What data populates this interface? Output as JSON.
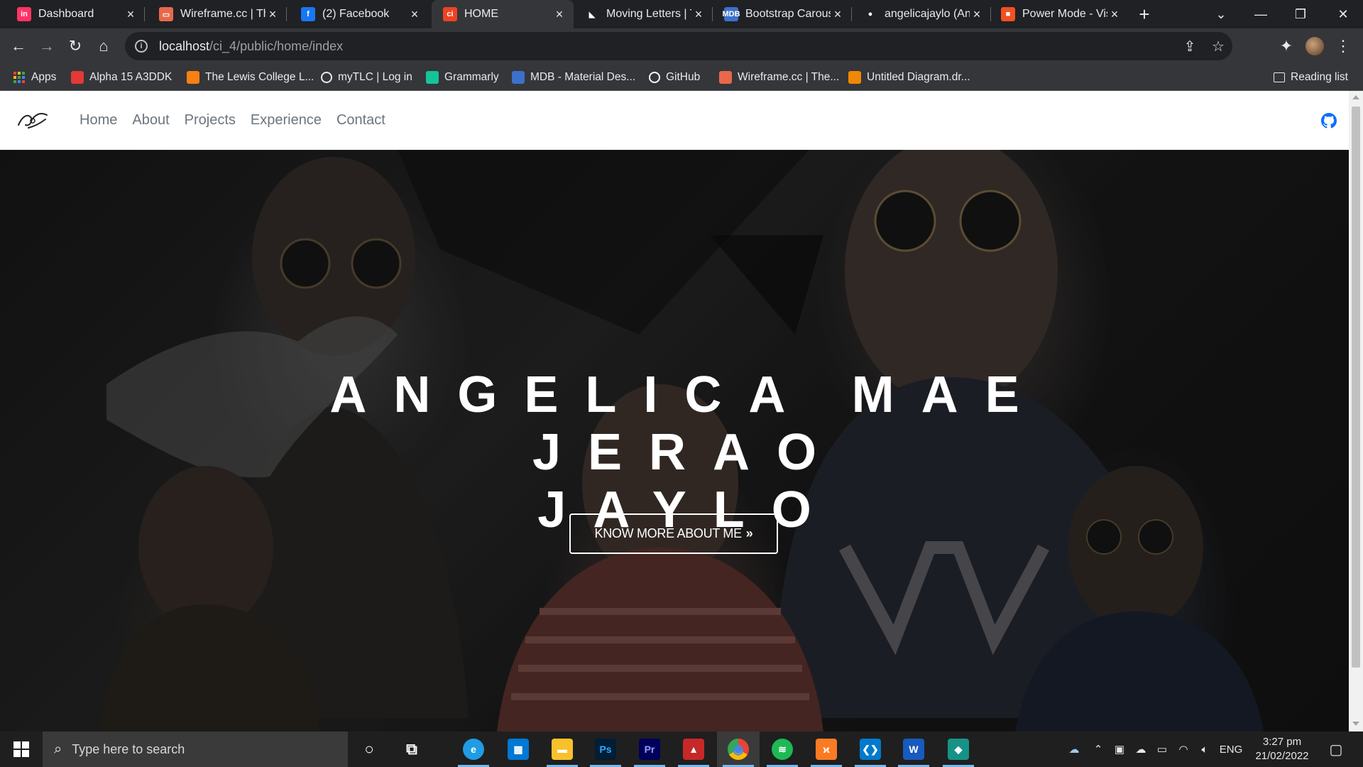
{
  "browser": {
    "tabs": [
      {
        "title": "Dashboard",
        "favicon": "invision-icon",
        "color": "#ff3366",
        "glyph": "in"
      },
      {
        "title": "Wireframe.cc | The",
        "favicon": "wireframe-icon",
        "color": "#e8684a",
        "glyph": "▭"
      },
      {
        "title": "(2) Facebook",
        "favicon": "facebook-icon",
        "color": "#1877f2",
        "glyph": "f"
      },
      {
        "title": "HOME",
        "favicon": "codeigniter-icon",
        "color": "#ee4323",
        "glyph": "ci",
        "active": true
      },
      {
        "title": "Moving Letters | T",
        "favicon": "moving-letters-icon",
        "color": "#ffffff",
        "glyph": "◣"
      },
      {
        "title": "Bootstrap Carous",
        "favicon": "mdb-icon",
        "color": "#3b71ca",
        "glyph": "MDB"
      },
      {
        "title": "angelicajaylo (An",
        "favicon": "github-icon",
        "color": "#ffffff",
        "glyph": "●"
      },
      {
        "title": "Power Mode - Vis",
        "favicon": "microsoft-icon",
        "color": "#f25022",
        "glyph": "■"
      }
    ],
    "address": {
      "host": "localhost",
      "path": "/ci_4/public/home/index"
    },
    "bookmarks": [
      {
        "label": "Apps",
        "icon": "apps-grid-icon",
        "color": "#4285f4"
      },
      {
        "label": "Alpha 15 A3DDK",
        "icon": "msi-icon",
        "color": "#e53935"
      },
      {
        "label": "The Lewis College L...",
        "icon": "moodle-icon",
        "color": "#f98012"
      },
      {
        "label": "myTLC | Log in",
        "icon": "globe-icon",
        "color": "#e8eaed"
      },
      {
        "label": "Grammarly",
        "icon": "grammarly-icon",
        "color": "#15c39a"
      },
      {
        "label": "MDB - Material Des...",
        "icon": "mdb-icon",
        "color": "#3b71ca"
      },
      {
        "label": "GitHub",
        "icon": "github-icon",
        "color": "#ffffff"
      },
      {
        "label": "Wireframe.cc | The...",
        "icon": "wireframe-icon",
        "color": "#e8684a"
      },
      {
        "label": "Untitled Diagram.dr...",
        "icon": "drawio-icon",
        "color": "#f08705"
      }
    ],
    "reading_list": "Reading list"
  },
  "site": {
    "nav": [
      "Home",
      "About",
      "Projects",
      "Experience",
      "Contact"
    ],
    "hero": {
      "title_lines": [
        "ANGELICA MAE",
        "JERAO",
        "JAYLO"
      ],
      "cta": "KNOW MORE ABOUT ME"
    },
    "colors": {
      "accent": "#0d6efd",
      "nav_text": "#6c757d"
    }
  },
  "taskbar": {
    "search_placeholder": "Type here to search",
    "apps": [
      {
        "name": "cortana-icon",
        "color": "#ffffff",
        "glyph": "○"
      },
      {
        "name": "task-view-icon",
        "color": "#ffffff",
        "glyph": "⧉"
      },
      {
        "name": "edge-icon",
        "color": "#1f9ce4",
        "glyph": "e"
      },
      {
        "name": "store-icon",
        "color": "#0078d4",
        "glyph": "▦"
      },
      {
        "name": "file-explorer-icon",
        "color": "#f8c12c",
        "glyph": "▬"
      },
      {
        "name": "photoshop-icon",
        "color": "#001e36",
        "glyph": "Ps"
      },
      {
        "name": "premiere-icon",
        "color": "#00005b",
        "glyph": "Pr"
      },
      {
        "name": "msi-dragon-icon",
        "color": "#c62828",
        "glyph": "▲"
      },
      {
        "name": "chrome-icon",
        "color": "#4caf50",
        "glyph": "◉"
      },
      {
        "name": "spotify-icon",
        "color": "#1db954",
        "glyph": "≋"
      },
      {
        "name": "xampp-icon",
        "color": "#fb7a24",
        "glyph": "ϰ"
      },
      {
        "name": "vscode-icon",
        "color": "#007acc",
        "glyph": "❮❯"
      },
      {
        "name": "word-icon",
        "color": "#185abd",
        "glyph": "W"
      },
      {
        "name": "gitkraken-icon",
        "color": "#179287",
        "glyph": "◆"
      }
    ],
    "language": "ENG",
    "time": "3:27 pm",
    "date": "21/02/2022"
  }
}
